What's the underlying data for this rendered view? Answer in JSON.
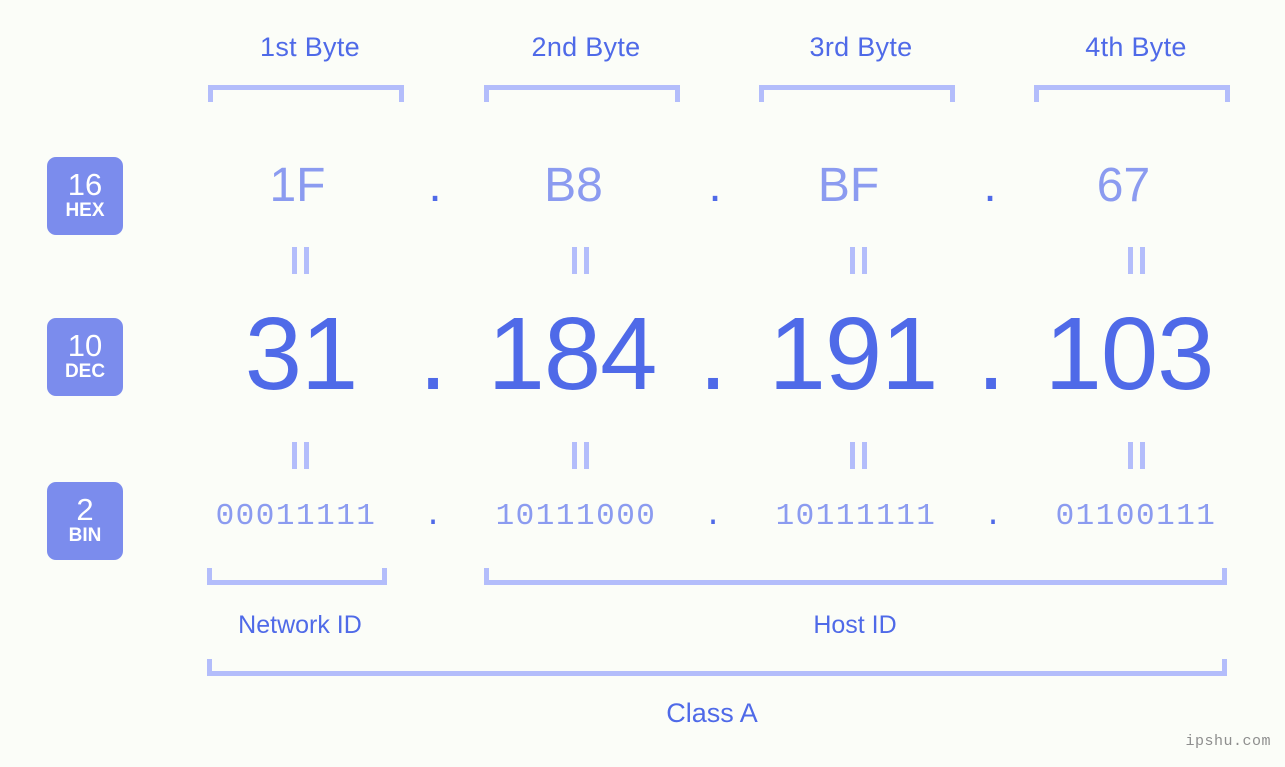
{
  "background_color": "#fbfdf8",
  "accent_color": "#4f6ae8",
  "light_accent_color": "#8b9bf0",
  "bracket_color": "#b3bdfb",
  "badge_color": "#7b8ced",
  "headers": {
    "bytes": [
      {
        "label": "1st Byte"
      },
      {
        "label": "2nd Byte"
      },
      {
        "label": "3rd Byte"
      },
      {
        "label": "4th Byte"
      }
    ]
  },
  "rows": {
    "hex": {
      "badge_number": "16",
      "badge_name": "HEX",
      "values": [
        "1F",
        "B8",
        "BF",
        "67"
      ],
      "separator": "."
    },
    "dec": {
      "badge_number": "10",
      "badge_name": "DEC",
      "values": [
        "31",
        "184",
        "191",
        "103"
      ],
      "separator": "."
    },
    "bin": {
      "badge_number": "2",
      "badge_name": "BIN",
      "values": [
        "00011111",
        "10111000",
        "10111111",
        "01100111"
      ],
      "separator": "."
    }
  },
  "equality_symbol": "=",
  "footer": {
    "network_id_label": "Network ID",
    "host_id_label": "Host ID",
    "class_label": "Class A"
  },
  "watermark": "ipshu.com"
}
